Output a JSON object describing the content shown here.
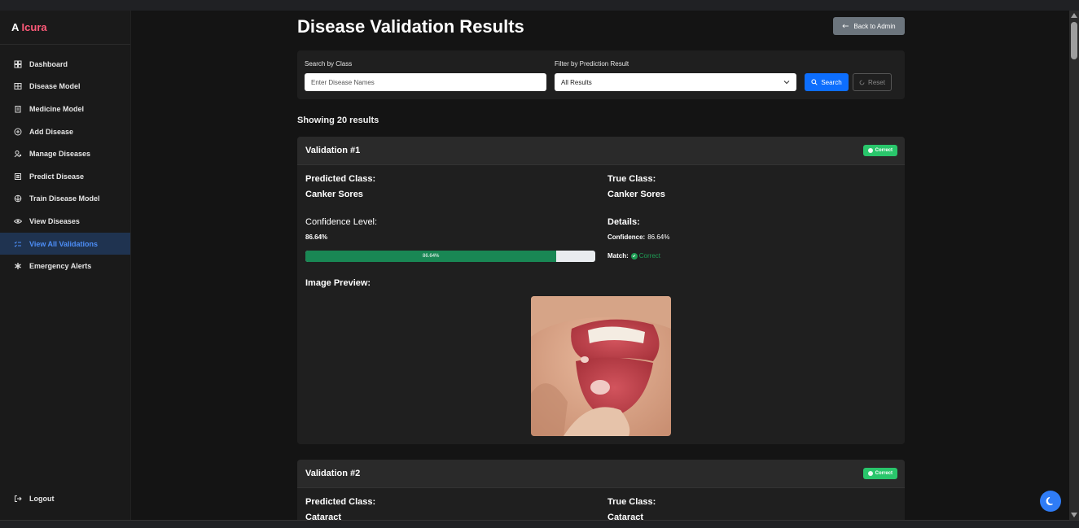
{
  "brand": {
    "part1": "A",
    "part2": "Icura"
  },
  "sidebar": {
    "items": [
      {
        "label": "Dashboard",
        "icon": "speedometer-icon"
      },
      {
        "label": "Disease Model",
        "icon": "model-icon"
      },
      {
        "label": "Medicine Model",
        "icon": "clipboard-icon"
      },
      {
        "label": "Add Disease",
        "icon": "plus-circle-icon"
      },
      {
        "label": "Manage Diseases",
        "icon": "people-gear-icon"
      },
      {
        "label": "Predict Disease",
        "icon": "list-icon"
      },
      {
        "label": "Train Disease Model",
        "icon": "train-icon"
      },
      {
        "label": "View Diseases",
        "icon": "eye-icon"
      },
      {
        "label": "View All Validations",
        "icon": "checklist-icon",
        "active": true
      },
      {
        "label": "Emergency Alerts",
        "icon": "asterisk-icon"
      }
    ],
    "logout_label": "Logout"
  },
  "page": {
    "title": "Disease Validation Results",
    "back_label": "Back to Admin"
  },
  "filters": {
    "search_label": "Search by Class",
    "search_placeholder": "Enter Disease Names",
    "search_value": "",
    "filter_label": "Filter by Prediction Result",
    "filter_selected": "All Results",
    "search_button": "Search",
    "reset_button": "Reset"
  },
  "results_count_text": "Showing 20 results",
  "validations": [
    {
      "title": "Validation #1",
      "badge": "Correct",
      "predicted_label": "Predicted Class:",
      "predicted_value": "Canker Sores",
      "true_label": "True Class:",
      "true_value": "Canker Sores",
      "confidence_label": "Confidence Level:",
      "confidence_text": "86.64%",
      "confidence_fraction": 0.8664,
      "details_label": "Details:",
      "detail_confidence_key": "Confidence:",
      "detail_confidence_value": "86.64%",
      "detail_match_key": "Match:",
      "detail_match_value": "Correct",
      "image_label": "Image Preview:"
    },
    {
      "title": "Validation #2",
      "badge": "Correct",
      "predicted_label": "Predicted Class:",
      "predicted_value": "Cataract",
      "true_label": "True Class:",
      "true_value": "Cataract"
    }
  ],
  "colors": {
    "accent": "#0d6efd",
    "success": "#29c66b",
    "progress": "#198754",
    "brand_pink": "#ff5a79",
    "active_nav_bg": "#1f3350"
  }
}
